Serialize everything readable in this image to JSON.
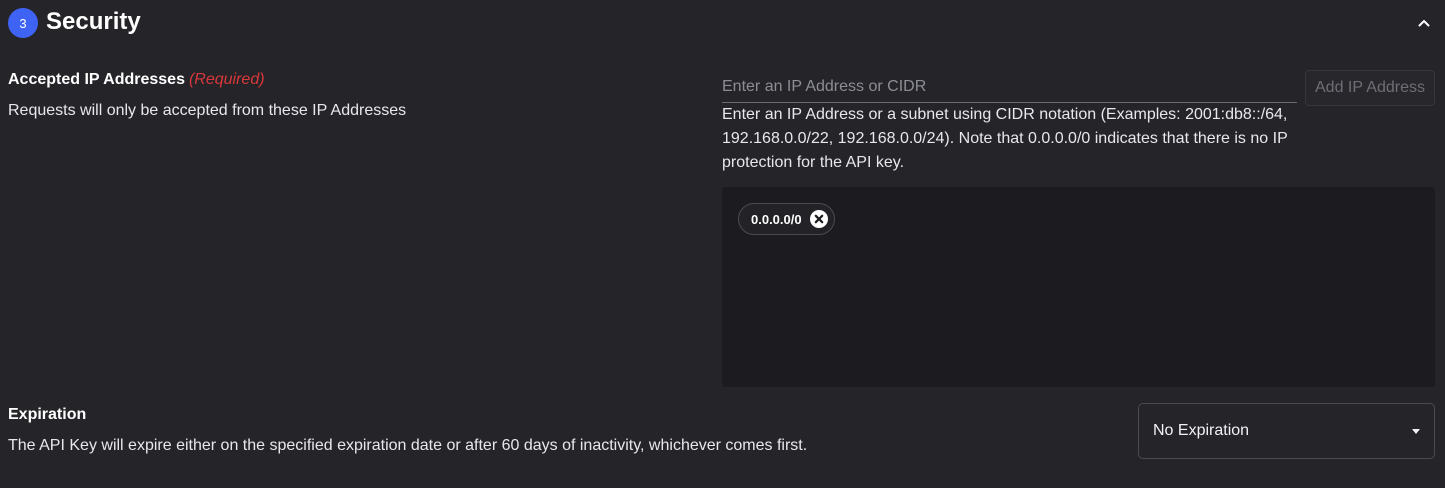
{
  "section": {
    "step_number": "3",
    "title": "Security"
  },
  "ip_addresses": {
    "label": "Accepted IP Addresses",
    "required_text": "(Required)",
    "description": "Requests will only be accepted from these IP Addresses",
    "input_placeholder": "Enter an IP Address or CIDR",
    "input_value": "",
    "add_button_label": "Add IP Address",
    "help_text": "Enter an IP Address or a subnet using CIDR notation (Examples: 2001:db8::/64, 192.168.0.0/22, 192.168.0.0/24). Note that 0.0.0.0/0 indicates that there is no IP protection for the API key.",
    "chips": [
      {
        "label": "0.0.0.0/0"
      }
    ]
  },
  "expiration": {
    "label": "Expiration",
    "description": "The API Key will expire either on the specified expiration date or after 60 days of inactivity, whichever comes first.",
    "selected_value": "No Expiration"
  },
  "icons": {
    "collapse": "chevron-up-icon",
    "chip_remove": "close-circle-icon",
    "select_caret": "caret-down-icon"
  },
  "colors": {
    "background": "#242429",
    "accent": "#3f63f5",
    "required": "#d9383a",
    "panel": "#1c1c20"
  }
}
